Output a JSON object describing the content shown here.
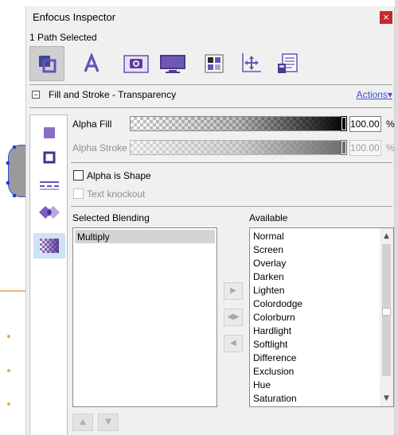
{
  "window": {
    "title": "Enfocus Inspector",
    "close_label": "×"
  },
  "selection_status": "1 Path Selected",
  "toolbar": {
    "tools": [
      {
        "icon": "fill-stroke-icon",
        "active": true
      },
      {
        "icon": "text-icon",
        "active": false
      },
      {
        "icon": "image-icon",
        "active": false
      },
      {
        "icon": "document-icon",
        "active": false
      },
      {
        "icon": "color-icon",
        "active": false
      },
      {
        "icon": "position-icon",
        "active": false
      },
      {
        "icon": "properties-icon",
        "active": false
      }
    ]
  },
  "section": {
    "collapse": "−",
    "title": "Fill and Stroke - Transparency",
    "actions": "Actions▾"
  },
  "tabs": [
    {
      "icon": "fill-square-icon",
      "active": false
    },
    {
      "icon": "stroke-square-icon",
      "active": false
    },
    {
      "icon": "dashed-lines-icon",
      "active": false
    },
    {
      "icon": "overlap-diamond-icon",
      "active": false
    },
    {
      "icon": "transparency-icon",
      "active": true
    }
  ],
  "alpha_fill": {
    "label": "Alpha Fill",
    "value": "100.00",
    "unit": "%",
    "level": 1.0
  },
  "alpha_stroke": {
    "label": "Alpha Stroke",
    "value": "100.00",
    "unit": "%",
    "level": 1.0,
    "disabled": true
  },
  "alpha_is_shape": {
    "label": "Alpha is Shape",
    "checked": false
  },
  "text_knockout": {
    "label": "Text knockout",
    "checked": false,
    "disabled": true
  },
  "selected_blending": {
    "label": "Selected Blending",
    "items": [
      "Multiply"
    ]
  },
  "available": {
    "label": "Available",
    "items": [
      "Normal",
      "Screen",
      "Overlay",
      "Darken",
      "Lighten",
      "Colordodge",
      "Colorburn",
      "Hardlight",
      "Softlight",
      "Difference",
      "Exclusion",
      "Hue",
      "Saturation"
    ]
  },
  "buttons": {
    "add": "▶",
    "swap": "◀▶",
    "remove": "◀",
    "move_up": "▲",
    "move_down": "▼"
  },
  "scroll": {
    "up": "▲",
    "down": "▼"
  }
}
